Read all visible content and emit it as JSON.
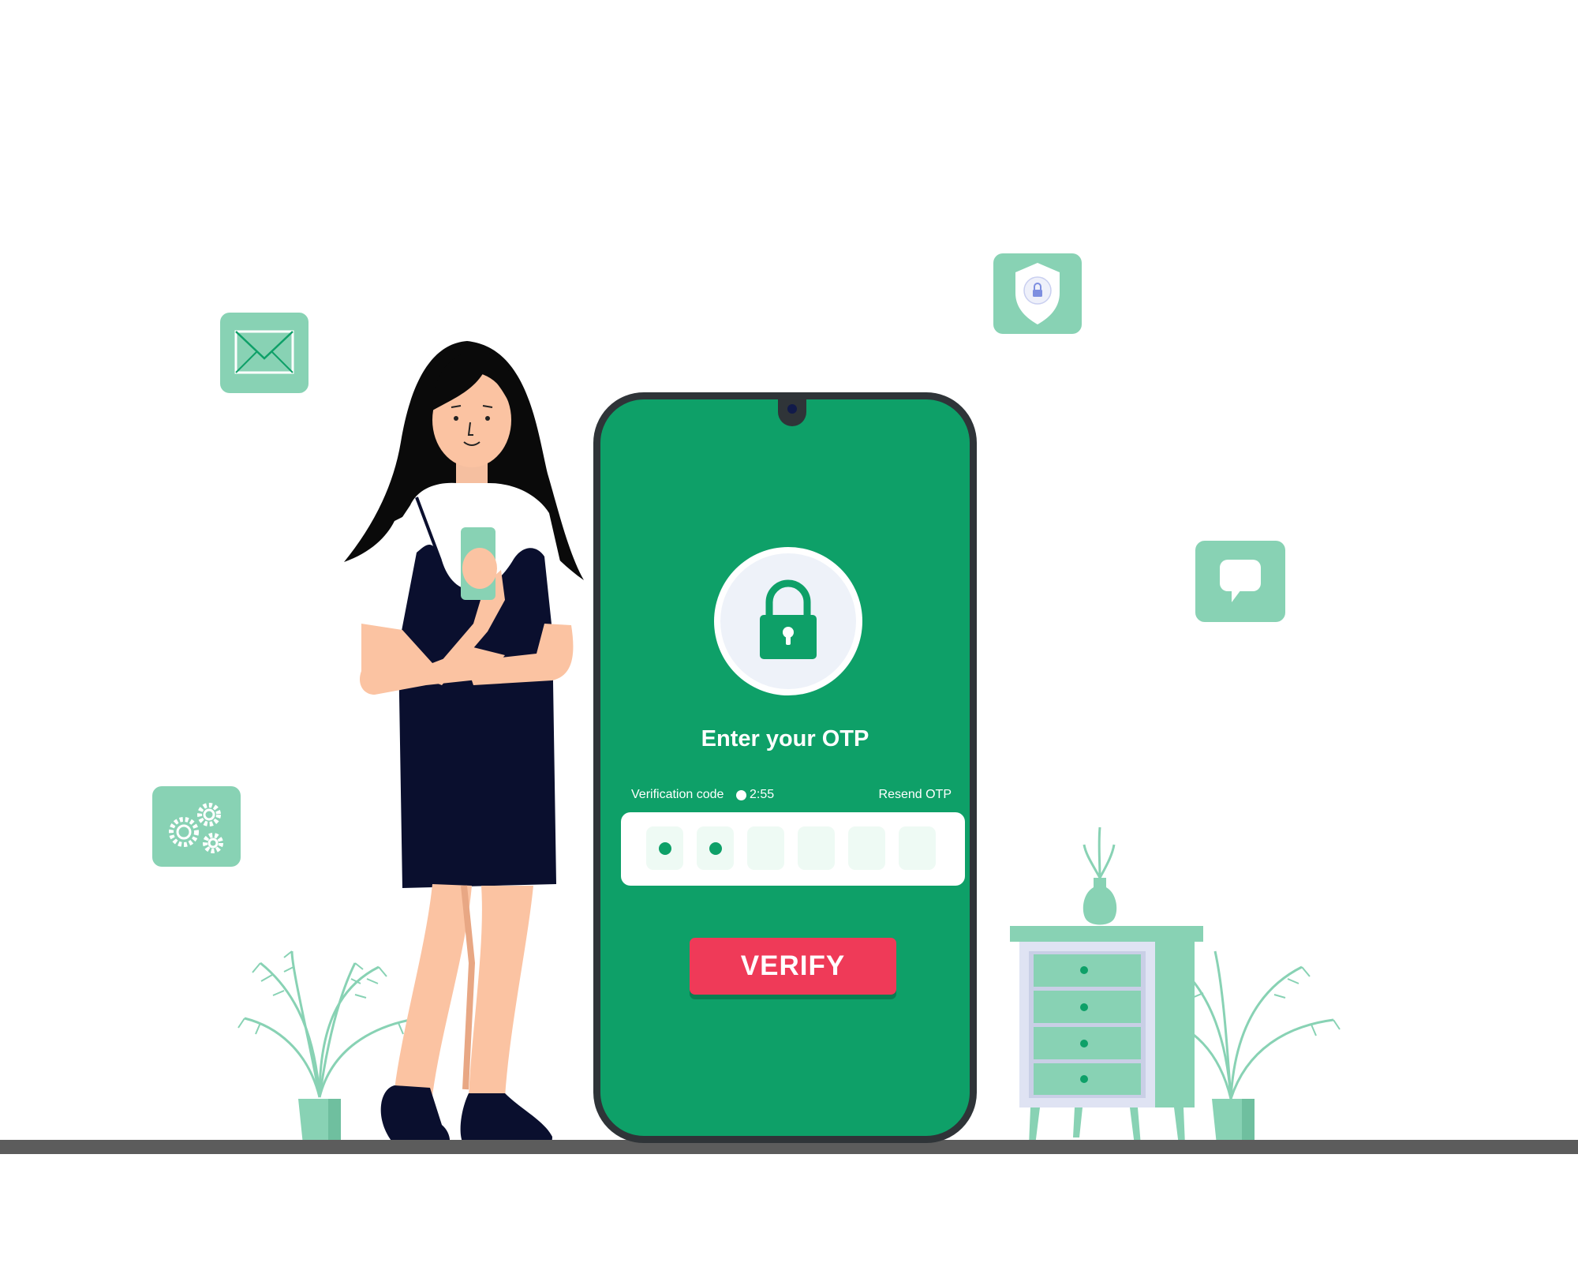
{
  "screen": {
    "title": "Enter your OTP",
    "verification_label": "Verification code",
    "timer": "2:55",
    "resend_label": "Resend OTP",
    "otp_digits_total": 6,
    "otp_digits_entered": 2,
    "verify_label": "VERIFY"
  },
  "floating_icons": [
    "envelope-icon",
    "shield-lock-icon",
    "chat-bubble-icon",
    "gears-icon"
  ],
  "colors": {
    "screen_green": "#0ea068",
    "tile_mint": "#88d2b4",
    "verify_red": "#ef3a58",
    "phone_frame": "#2f3438",
    "dress_navy": "#0a0f2e"
  }
}
